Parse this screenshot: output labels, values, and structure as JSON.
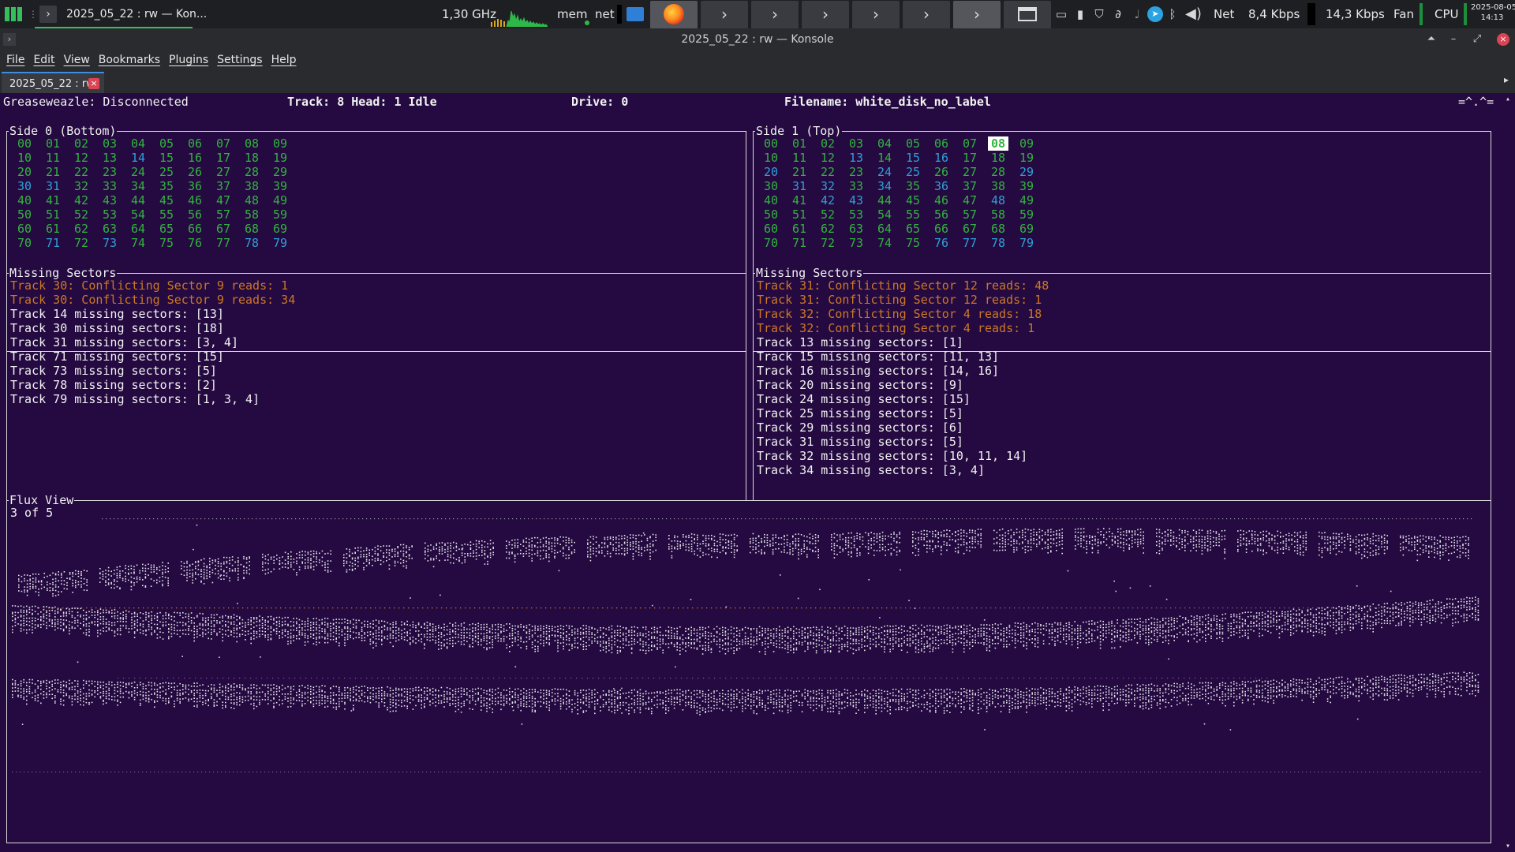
{
  "panel": {
    "active_task_title": "2025_05_22 : rw — Kon...",
    "cpu_freq": "1,30 GHz",
    "mem_label": "mem",
    "net_label": "net",
    "net_text": "Net",
    "download": "8,4 Kbps",
    "upload": "14,3 Kbps",
    "fan_label": "Fan",
    "cpu_label": "CPU",
    "date": "2025-08-05",
    "time": "14:13"
  },
  "window": {
    "title": "2025_05_22 : rw — Konsole"
  },
  "menu": [
    "File",
    "Edit",
    "View",
    "Bookmarks",
    "Plugins",
    "Settings",
    "Help"
  ],
  "tab": {
    "label": "2025_05_22 : rw",
    "close": "×"
  },
  "status": {
    "greaseweazle": "Greaseweazle: Disconnected",
    "track_head": "Track: 8 Head: 1 Idle",
    "drive": "Drive: 0",
    "filename": "Filename: white_disk_no_label",
    "corner": "=^.^="
  },
  "side0": {
    "title": "Side 0 (Bottom)",
    "blue_tracks": [
      "14",
      "30",
      "31",
      "71",
      "73",
      "78",
      "79"
    ],
    "selected": ""
  },
  "side1": {
    "title": "Side 1 (Top)",
    "blue_tracks": [
      "13",
      "15",
      "16",
      "20",
      "24",
      "25",
      "29",
      "31",
      "32",
      "34",
      "36",
      "42",
      "43",
      "48",
      "76",
      "77",
      "78",
      "79"
    ],
    "selected": "08"
  },
  "missing0": {
    "title": "Missing Sectors",
    "warnings": [
      "Track 30: Conflicting Sector 9 reads: 1",
      "Track 30: Conflicting Sector 9 reads: 34"
    ],
    "lines": [
      "Track 14 missing sectors: [13]",
      "Track 30 missing sectors: [18]",
      "Track 31 missing sectors: [3, 4]",
      "Track 71 missing sectors: [15]",
      "Track 73 missing sectors: [5]",
      "Track 78 missing sectors: [2]",
      "Track 79 missing sectors: [1, 3, 4]"
    ]
  },
  "missing1": {
    "title": "Missing Sectors",
    "warnings": [
      "Track 31: Conflicting Sector 12 reads: 48",
      "Track 31: Conflicting Sector 12 reads: 1",
      "Track 32: Conflicting Sector 4 reads: 18",
      "Track 32: Conflicting Sector 4 reads: 1"
    ],
    "lines": [
      "Track 13 missing sectors: [1]",
      "Track 15 missing sectors: [11, 13]",
      "Track 16 missing sectors: [14, 16]",
      "Track 20 missing sectors: [9]",
      "Track 24 missing sectors: [15]",
      "Track 25 missing sectors: [5]",
      "Track 29 missing sectors: [6]",
      "Track 31 missing sectors: [5]",
      "Track 32 missing sectors: [10, 11, 14]",
      "Track 34 missing sectors: [3, 4]"
    ]
  },
  "flux": {
    "title": "Flux View",
    "page": "3 of 5"
  },
  "colors": {
    "terminal_bg": "#240a40",
    "track_good": "#33b33f",
    "track_blue": "#2fa0d7",
    "warning": "#cc7826",
    "accent": "#35bf5c"
  }
}
